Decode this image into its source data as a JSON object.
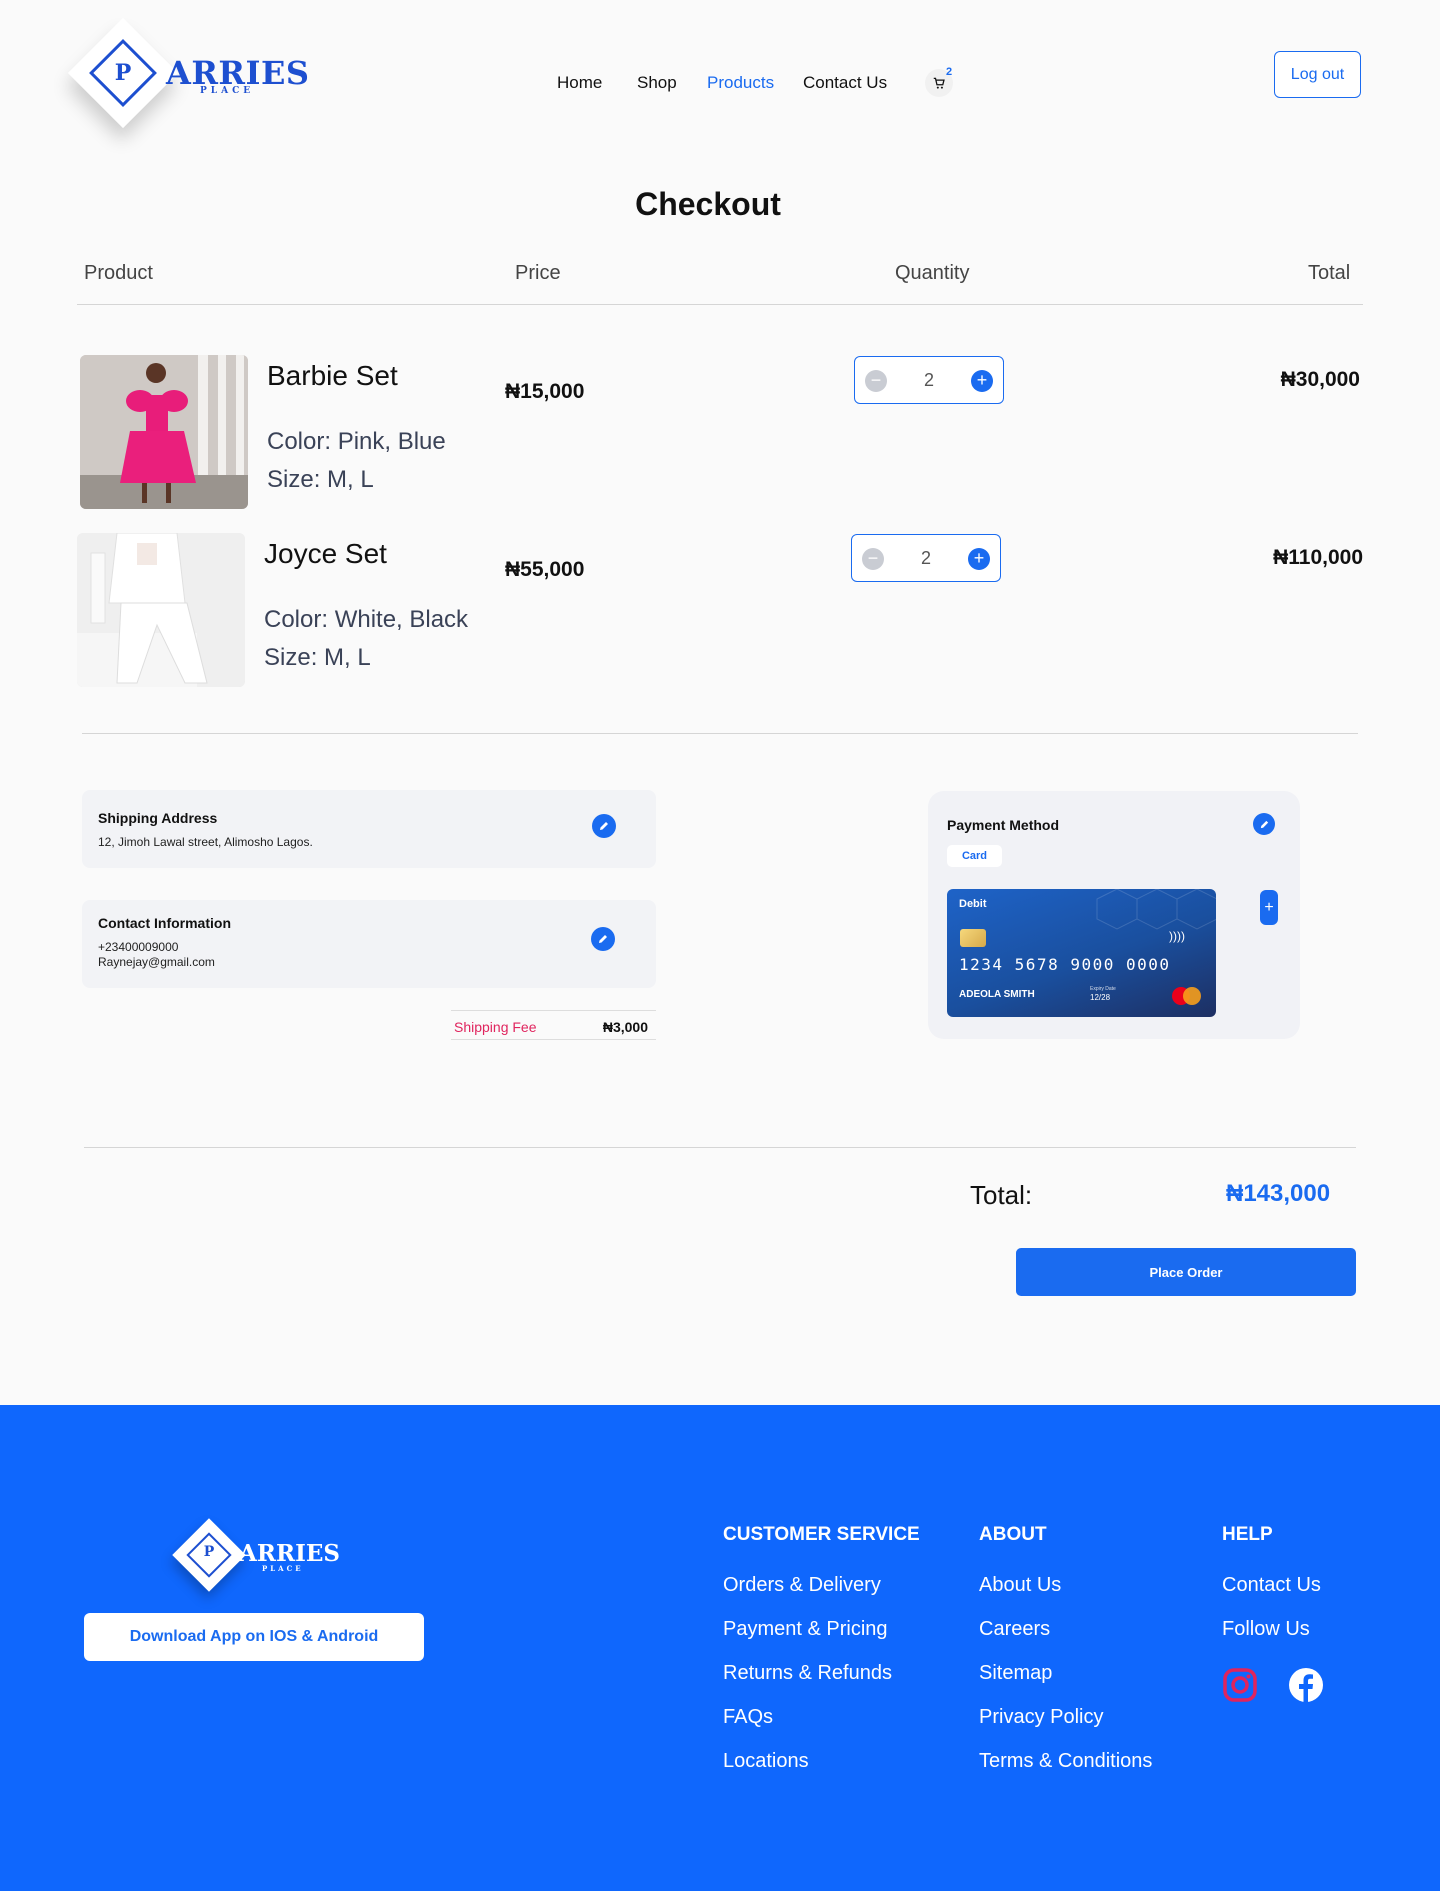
{
  "brand": {
    "name": "ARRIES",
    "sub": "PLACE",
    "glyph": "P"
  },
  "nav": {
    "home": "Home",
    "shop": "Shop",
    "products": "Products",
    "contact": "Contact Us",
    "cart_count": "2",
    "logout": "Log out"
  },
  "page": {
    "title": "Checkout"
  },
  "table_headers": {
    "product": "Product",
    "price": "Price",
    "quantity": "Quantity",
    "total": "Total"
  },
  "items": [
    {
      "name": "Barbie Set",
      "color": "Color: Pink, Blue",
      "size": "Size: M, L",
      "price": "₦15,000",
      "qty": "2",
      "total": "₦30,000"
    },
    {
      "name": "Joyce Set",
      "color": "Color: White, Black",
      "size": "Size: M, L",
      "price": "₦55,000",
      "qty": "2",
      "total": "₦110,000"
    }
  ],
  "shipping": {
    "title": "Shipping Address",
    "address": "12, Jimoh Lawal street, Alimosho Lagos."
  },
  "contact": {
    "title": "Contact Information",
    "phone": "+23400009000",
    "email": "Raynejay@gmail.com"
  },
  "shipping_fee": {
    "label": "Shipping Fee",
    "amount": "₦3,000"
  },
  "payment": {
    "title": "Payment Method",
    "tag": "Card",
    "card": {
      "type": "Debit",
      "number": "1234 5678 9000 0000",
      "holder": "ADEOLA SMITH",
      "expiry_label": "Expiry Date",
      "expiry": "12/28"
    }
  },
  "summary": {
    "total_label": "Total:",
    "total_value": "₦143,000",
    "place_order": "Place Order"
  },
  "footer": {
    "download": "Download App on IOS & Android",
    "customer_service": {
      "title": "CUSTOMER SERVICE",
      "links": [
        "Orders & Delivery",
        "Payment & Pricing",
        "Returns & Refunds",
        "FAQs",
        "Locations"
      ]
    },
    "about": {
      "title": "ABOUT",
      "links": [
        "About Us",
        "Careers",
        "Sitemap",
        "Privacy Policy",
        "Terms & Conditions"
      ]
    },
    "help": {
      "title": "HELP",
      "links": [
        "Contact Us",
        "Follow Us"
      ]
    },
    "social": [
      "instagram-icon",
      "facebook-icon"
    ]
  },
  "colors": {
    "primary": "#1a6bf0",
    "footer_bg": "#0f67fd",
    "shipping_fee_label": "#e0245e"
  }
}
